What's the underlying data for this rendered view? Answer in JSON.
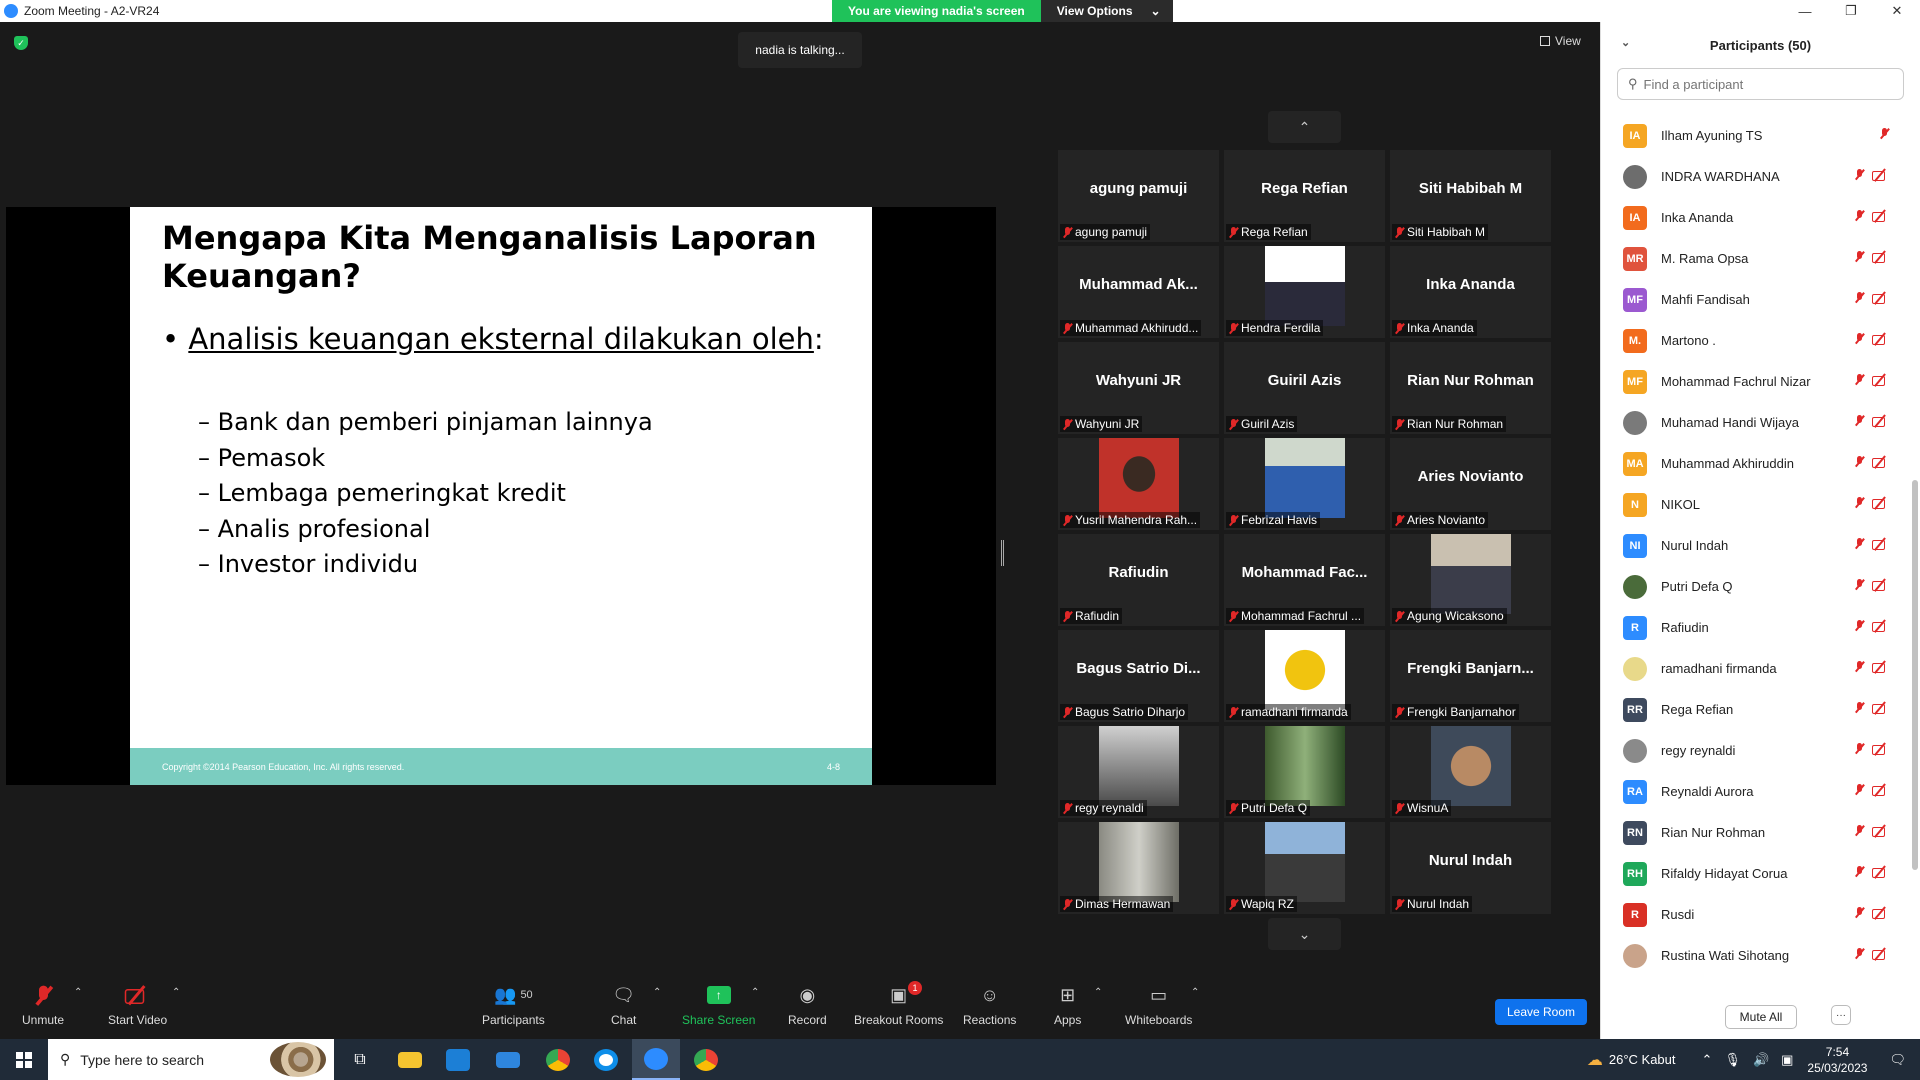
{
  "window": {
    "title": "Zoom Meeting - A2-VR24"
  },
  "banner": {
    "viewing": "You are viewing nadia's screen",
    "view_options": "View Options"
  },
  "talking": "nadia is talking...",
  "view_label": "View",
  "slide": {
    "title": "Mengapa Kita Menganalisis Laporan Keuangan?",
    "bullet": "Analisis keuangan eksternal dilakukan oleh",
    "bullet_colon": ":",
    "items": [
      "Bank dan pemberi pinjaman lainnya",
      "Pemasok",
      "Lembaga pemeringkat kredit",
      "Analis profesional",
      "Investor individu"
    ],
    "copyright": "Copyright ©2014 Pearson Education, Inc. All rights reserved.",
    "page": "4-8"
  },
  "gallery": {
    "tiles": [
      {
        "big": "agung pamuji",
        "label": "agung pamuji"
      },
      {
        "big": "Rega Refian",
        "label": "Rega Refian"
      },
      {
        "big": "Siti Habibah M",
        "label": "Siti Habibah M"
      },
      {
        "big": "Muhammad  Ak...",
        "label": "Muhammad Akhirudd..."
      },
      {
        "big": "",
        "label": "Hendra Ferdila",
        "photo": "suit"
      },
      {
        "big": "Inka Ananda",
        "label": "Inka Ananda"
      },
      {
        "big": "Wahyuni JR",
        "label": "Wahyuni JR"
      },
      {
        "big": "Guiril Azis",
        "label": "Guiril Azis"
      },
      {
        "big": "Rian Nur Rohman",
        "label": "Rian Nur Rohman"
      },
      {
        "big": "",
        "label": "Yusril Mahendra Rah...",
        "photo": "red"
      },
      {
        "big": "",
        "label": "Febrizal Havis",
        "photo": "outdoor"
      },
      {
        "big": "Aries Novianto",
        "label": "Aries Novianto"
      },
      {
        "big": "Rafiudin",
        "label": "Rafiudin"
      },
      {
        "big": "Mohammad  Fac...",
        "label": "Mohammad Fachrul ..."
      },
      {
        "big": "",
        "label": "Agung Wicaksono",
        "photo": "indoor"
      },
      {
        "big": "Bagus Satrio  Di...",
        "label": "Bagus Satrio Diharjo"
      },
      {
        "big": "",
        "label": "ramadhani firmanda",
        "photo": "emblem"
      },
      {
        "big": "Frengki  Banjarn...",
        "label": "Frengki Banjarnahor"
      },
      {
        "big": "",
        "label": "regy reynaldi",
        "photo": "bw"
      },
      {
        "big": "",
        "label": "Putri Defa Q",
        "photo": "forest"
      },
      {
        "big": "",
        "label": "WisnuA",
        "photo": "portrait"
      },
      {
        "big": "",
        "label": "Dimas Hermawan",
        "photo": "trees"
      },
      {
        "big": "",
        "label": "Wapiq RZ",
        "photo": "city"
      },
      {
        "big": "Nurul Indah",
        "label": "Nurul Indah"
      }
    ]
  },
  "toolbar": {
    "unmute": "Unmute",
    "start_video": "Start Video",
    "participants": "Participants",
    "participants_count": "50",
    "chat": "Chat",
    "share_screen": "Share Screen",
    "record": "Record",
    "breakout": "Breakout Rooms",
    "breakout_badge": "1",
    "reactions": "Reactions",
    "apps": "Apps",
    "whiteboards": "Whiteboards",
    "leave": "Leave Room"
  },
  "panel": {
    "title": "Participants (50)",
    "search_placeholder": "Find a participant",
    "mute_all": "Mute All",
    "more": "···",
    "participants": [
      {
        "initials": "IA",
        "name": "Ilham Ayuning TS",
        "color": "#f5a623",
        "video_icon": false
      },
      {
        "initials": "",
        "name": "INDRA WARDHANA",
        "color": "#6d6d6d",
        "video_icon": true
      },
      {
        "initials": "IA",
        "name": "Inka Ananda",
        "color": "#f26b1d",
        "video_icon": true
      },
      {
        "initials": "MR",
        "name": "M. Rama Opsa",
        "color": "#e0533d",
        "video_icon": true
      },
      {
        "initials": "MF",
        "name": "Mahfi Fandisah",
        "color": "#9b59d0",
        "video_icon": true
      },
      {
        "initials": "M.",
        "name": "Martono .",
        "color": "#f26b1d",
        "video_icon": true
      },
      {
        "initials": "MF",
        "name": "Mohammad Fachrul Nizar",
        "color": "#f5a623",
        "video_icon": true
      },
      {
        "initials": "",
        "name": "Muhamad Handi Wijaya",
        "color": "#7a7a7a",
        "video_icon": true
      },
      {
        "initials": "MA",
        "name": "Muhammad Akhiruddin",
        "color": "#f5a623",
        "video_icon": true
      },
      {
        "initials": "N",
        "name": "NIKOL",
        "color": "#f5a623",
        "video_icon": true
      },
      {
        "initials": "NI",
        "name": "Nurul Indah",
        "color": "#2d8cff",
        "video_icon": true
      },
      {
        "initials": "",
        "name": "Putri Defa Q",
        "color": "#4a6b3a",
        "video_icon": true
      },
      {
        "initials": "R",
        "name": "Rafiudin",
        "color": "#2d8cff",
        "video_icon": true
      },
      {
        "initials": "",
        "name": "ramadhani firmanda",
        "color": "#e8d98a",
        "video_icon": true
      },
      {
        "initials": "RR",
        "name": "Rega Refian",
        "color": "#3e4a5e",
        "video_icon": true
      },
      {
        "initials": "",
        "name": "regy reynaldi",
        "color": "#8a8a8a",
        "video_icon": true
      },
      {
        "initials": "RA",
        "name": "Reynaldi Aurora",
        "color": "#2d8cff",
        "video_icon": true
      },
      {
        "initials": "RN",
        "name": "Rian Nur Rohman",
        "color": "#3e4a5e",
        "video_icon": true
      },
      {
        "initials": "RH",
        "name": "Rifaldy Hidayat Corua",
        "color": "#1fa85a",
        "video_icon": true
      },
      {
        "initials": "R",
        "name": "Rusdi",
        "color": "#d93025",
        "video_icon": true
      },
      {
        "initials": "",
        "name": "Rustina Wati Sihotang",
        "color": "#c9a38a",
        "video_icon": true
      }
    ]
  },
  "taskbar": {
    "search_placeholder": "Type here to search",
    "weather": "26°C  Kabut",
    "time": "7:54",
    "date": "25/03/2023"
  }
}
